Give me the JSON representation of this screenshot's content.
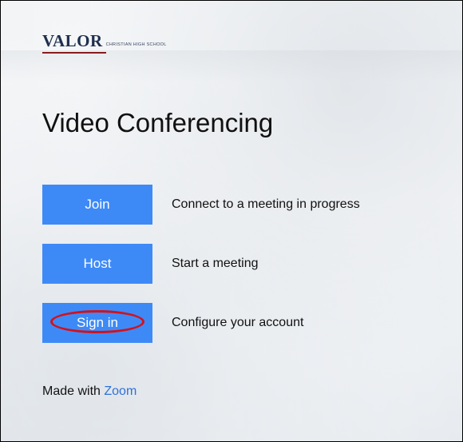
{
  "logo": {
    "word": "VALOR",
    "subtitle": "CHRISTIAN HIGH SCHOOL"
  },
  "page_title": "Video Conferencing",
  "actions": [
    {
      "label": "Join",
      "description": "Connect to a meeting in progress"
    },
    {
      "label": "Host",
      "description": "Start a meeting"
    },
    {
      "label": "Sign in",
      "description": "Configure your account"
    }
  ],
  "footer": {
    "prefix": "Made with",
    "link": "Zoom"
  },
  "colors": {
    "button": "#3d8af7",
    "link": "#2d72d9",
    "highlight": "#d4111a",
    "logo": "#1f2f4d"
  }
}
